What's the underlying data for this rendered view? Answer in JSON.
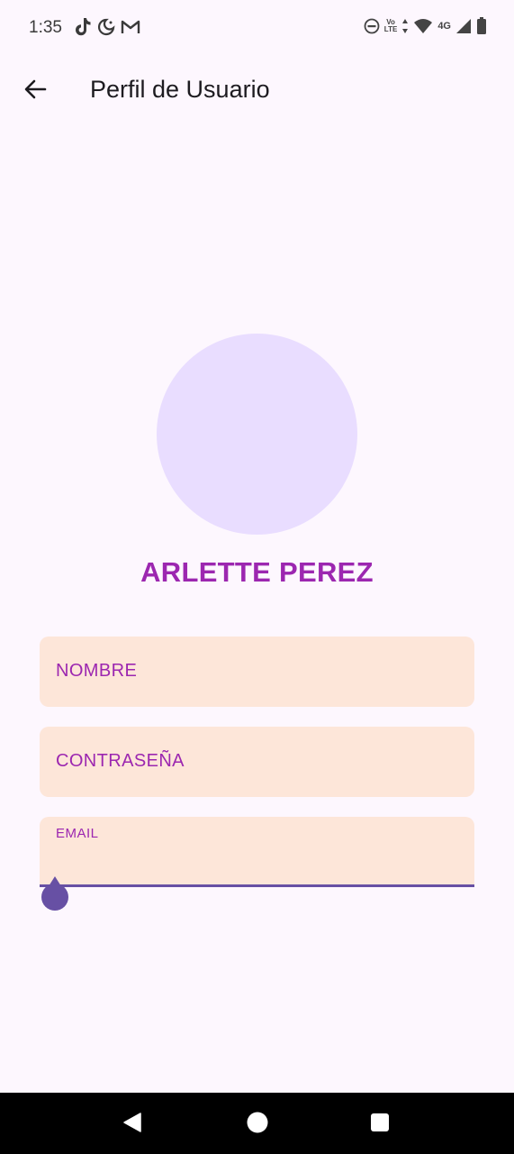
{
  "status_bar": {
    "time": "1:35",
    "left_icons": [
      "tiktok-icon",
      "moon-icon",
      "gmail-icon"
    ],
    "right_icons": [
      "dnd-icon",
      "volte-icon",
      "data-arrows-icon",
      "wifi-icon",
      "4g-signal-icon",
      "battery-icon"
    ],
    "volte_text": "Vo LTE",
    "network_text": "4G"
  },
  "app_bar": {
    "back_icon": "arrow-back-icon",
    "title": "Perfil de Usuario"
  },
  "profile": {
    "avatar_color": "#e9ddff",
    "name": "ARLETTE PEREZ",
    "name_color": "#9c27b0"
  },
  "form": {
    "name_label": "NOMBRE",
    "password_label": "CONTRASEÑA",
    "email_label": "EMAIL",
    "field_background": "#fde6d9",
    "focus_color": "#6750a4"
  },
  "nav_bar": {
    "buttons": [
      "back-triangle-icon",
      "home-circle-icon",
      "recents-square-icon"
    ]
  }
}
